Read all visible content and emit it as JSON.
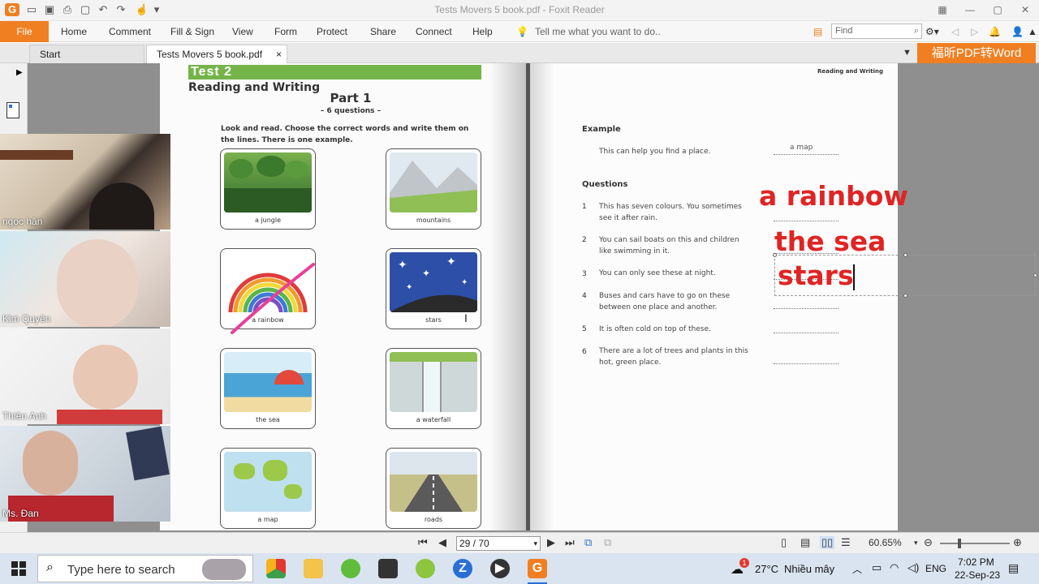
{
  "window": {
    "title": "Tests Movers 5 book.pdf - Foxit Reader"
  },
  "ribbon": {
    "file": "File",
    "tabs": [
      "Home",
      "Comment",
      "Fill & Sign",
      "View",
      "Form",
      "Protect",
      "Share",
      "Connect",
      "Help"
    ],
    "tell_me": "Tell me what you want to do..",
    "find_placeholder": "Find"
  },
  "doc_tabs": {
    "start": "Start",
    "active": "Tests Movers 5 book.pdf",
    "close": "×",
    "convert": "福昕PDF转Word"
  },
  "left_page": {
    "banner": "Test 2",
    "section": "Reading and Writing",
    "part": "Part 1",
    "questions_count": "– 6 questions –",
    "instruction": "Look and read. Choose the correct words and write them on the lines. There is one example.",
    "cards": [
      "a jungle",
      "mountains",
      "a rainbow",
      "stars",
      "the sea",
      "a waterfall",
      "a map",
      "roads"
    ]
  },
  "right_page": {
    "header": "Reading and Writing",
    "example_label": "Example",
    "example_text": "This can help you find a place.",
    "example_answer": "a map",
    "questions_label": "Questions",
    "questions": [
      {
        "n": "1",
        "text": "This has seven colours. You sometimes see it after rain."
      },
      {
        "n": "2",
        "text": "You can sail boats on this and children like swimming in it."
      },
      {
        "n": "3",
        "text": "You can only see these at night."
      },
      {
        "n": "4",
        "text": "Buses and cars have to go on these between one place and another."
      },
      {
        "n": "5",
        "text": "It is often cold on top of these."
      },
      {
        "n": "6",
        "text": "There are a lot of trees and plants in this hot, green place."
      }
    ],
    "typed_answers": [
      "a rainbow",
      "the sea",
      "stars"
    ]
  },
  "participants": [
    "ngọc hân",
    "Kim Quyên",
    "Thiên Anh",
    "Ms. Đan"
  ],
  "status": {
    "page": "29 / 70",
    "zoom": "60.65%"
  },
  "taskbar": {
    "search_placeholder": "Type here to search",
    "weather_temp": "27°C",
    "weather_desc": "Nhiều mây",
    "weather_badge": "1",
    "lang": "ENG",
    "time": "7:02 PM",
    "date": "22-Sep-23"
  },
  "colors": {
    "accent": "#f07f22",
    "answer_red": "#e02424",
    "banner_green": "#74b449"
  }
}
